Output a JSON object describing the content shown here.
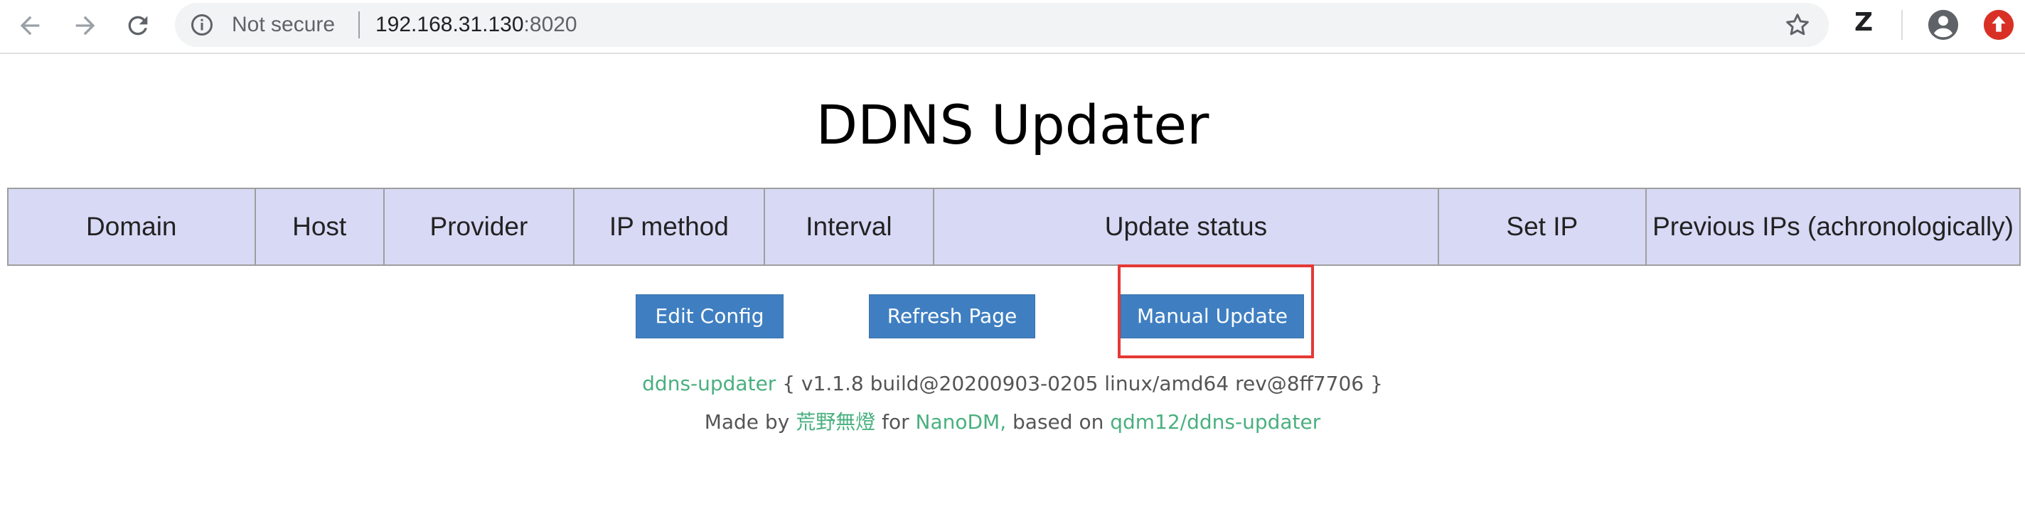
{
  "browser": {
    "security_label": "Not secure",
    "url_host": "192.168.31.130",
    "url_port": ":8020",
    "extension_label": "Z"
  },
  "page": {
    "title": "DDNS Updater"
  },
  "table": {
    "headers": [
      "Domain",
      "Host",
      "Provider",
      "IP method",
      "Interval",
      "Update status",
      "Set IP",
      "Previous IPs (achronologically)"
    ]
  },
  "buttons": {
    "edit_config": "Edit Config",
    "refresh_page": "Refresh Page",
    "manual_update": "Manual Update"
  },
  "footer": {
    "app_link": "ddns-updater",
    "version_info": "{ v1.1.8 build@20200903-0205 linux/amd64 rev@8ff7706 }",
    "made_by": "Made by",
    "author_link": "荒野無燈",
    "for_text": "for",
    "nanodm_link": "NanoDM,",
    "based_on": "based on",
    "upstream_link": "qdm12/ddns-updater"
  },
  "colors": {
    "accent_button": "#3f7fc1",
    "table_header_bg": "#d8d9f5",
    "link": "#49b07f",
    "highlight": "#e53935"
  }
}
